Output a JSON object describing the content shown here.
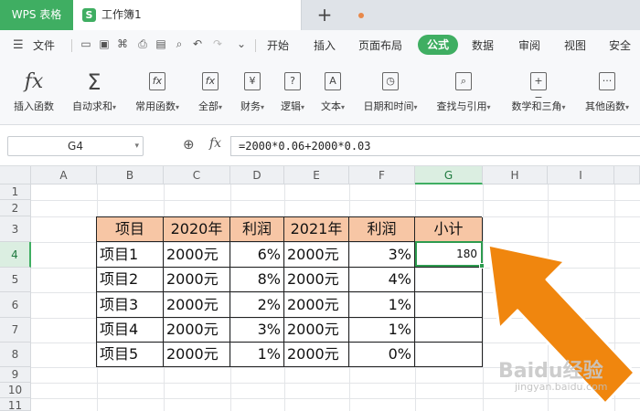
{
  "app_tab": "WPS 表格",
  "doc_tab": {
    "icon": "S",
    "title": "工作簿1"
  },
  "new_tab": "+",
  "menu": {
    "file": "文件",
    "tabs": [
      "开始",
      "插入",
      "页面布局",
      "公式",
      "数据",
      "审阅",
      "视图",
      "安全"
    ],
    "active_tab": "公式"
  },
  "ribbon": [
    {
      "label": "插入函数",
      "icon": "fx"
    },
    {
      "label": "自动求和",
      "icon": "Σ",
      "dd": true
    },
    {
      "label": "常用函数",
      "icon": "fx",
      "dd": true
    },
    {
      "label": "全部",
      "icon": "fx",
      "dd": true
    },
    {
      "label": "财务",
      "icon": "¥",
      "dd": true
    },
    {
      "label": "逻辑",
      "icon": "?",
      "dd": true
    },
    {
      "label": "文本",
      "icon": "A",
      "dd": true
    },
    {
      "label": "日期和时间",
      "icon": "◷",
      "dd": true
    },
    {
      "label": "查找与引用",
      "icon": "⌕",
      "dd": true
    },
    {
      "label": "数学和三角",
      "icon": "+−",
      "dd": true
    },
    {
      "label": "其他函数",
      "icon": "···",
      "dd": true
    }
  ],
  "formula_bar": {
    "name_box": "G4",
    "fx": "fx",
    "formula": "=2000*0.06+2000*0.03"
  },
  "columns": [
    "A",
    "B",
    "C",
    "D",
    "E",
    "F",
    "G",
    "H",
    "I"
  ],
  "rows": [
    "1",
    "2",
    "3",
    "4",
    "5",
    "6",
    "7",
    "8",
    "9",
    "10",
    "11"
  ],
  "selected_col": "G",
  "selected_row": "4",
  "table": {
    "headers": [
      "项目",
      "2020年",
      "利润",
      "2021年",
      "利润",
      "小计"
    ],
    "rows": [
      [
        "项目1",
        "2000元",
        "6%",
        "2000元",
        "3%",
        "180"
      ],
      [
        "项目2",
        "2000元",
        "8%",
        "2000元",
        "4%",
        ""
      ],
      [
        "项目3",
        "2000元",
        "2%",
        "2000元",
        "1%",
        ""
      ],
      [
        "项目4",
        "2000元",
        "3%",
        "2000元",
        "1%",
        ""
      ],
      [
        "项目5",
        "2000元",
        "1%",
        "2000元",
        "0%",
        ""
      ]
    ]
  },
  "watermark": {
    "title": "Baidu经验",
    "url": "jingyan.baidu.com"
  },
  "colors": {
    "accent": "#3fae62",
    "header_fill": "#f7c6a5",
    "arrow": "#f0860e"
  }
}
